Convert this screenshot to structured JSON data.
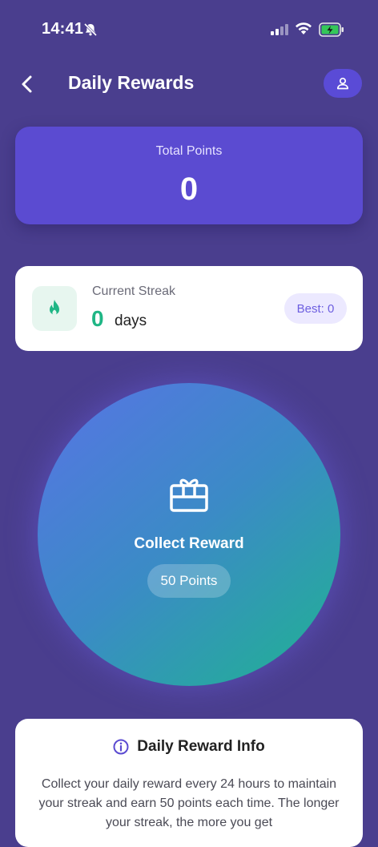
{
  "status_bar": {
    "time": "14:41"
  },
  "header": {
    "title": "Daily Rewards"
  },
  "points_card": {
    "label": "Total Points",
    "value": "0"
  },
  "streak_card": {
    "label": "Current Streak",
    "value": "0",
    "unit": "days",
    "best": "Best: 0"
  },
  "reward": {
    "label": "Collect Reward",
    "points": "50 Points"
  },
  "info": {
    "title": "Daily Reward Info",
    "body": "Collect your daily reward every 24 hours to maintain your streak and earn 50 points each time. The longer your streak, the more you get"
  },
  "colors": {
    "background": "#4a3e8e",
    "accent": "#5b4bd1",
    "success": "#1fb685"
  },
  "icons": [
    "bell-slash-icon",
    "signal-icon",
    "wifi-icon",
    "battery-icon",
    "back-chevron-icon",
    "user-icon",
    "flame-icon",
    "gift-icon",
    "info-icon"
  ]
}
